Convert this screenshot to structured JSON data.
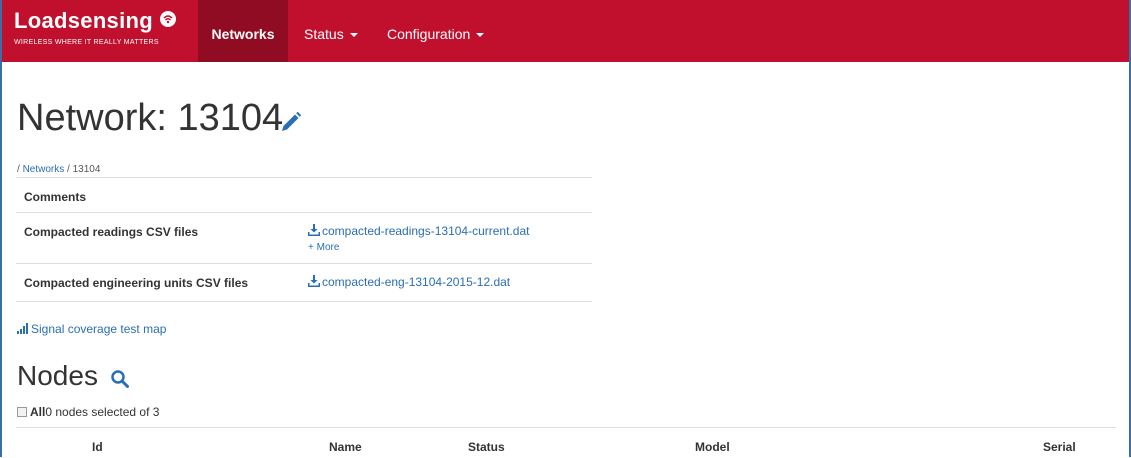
{
  "brand": {
    "name": "Loadsensing",
    "tagline": "WIRELESS WHERE IT REALLY MATTERS"
  },
  "nav": {
    "networks": "Networks",
    "status": "Status",
    "configuration": "Configuration"
  },
  "page": {
    "title": "Network: 13104",
    "breadcrumb": {
      "sep1": "/ ",
      "networks": "Networks",
      "sep2": " / ",
      "current": "13104"
    }
  },
  "info": {
    "comments_label": "Comments",
    "readings_label": "Compacted readings CSV files",
    "readings_file": "compacted-readings-13104-current.dat",
    "more": "+ More",
    "eng_label": "Compacted engineering units CSV files",
    "eng_file": "compacted-eng-13104-2015-12.dat"
  },
  "signal_link": "Signal coverage test map",
  "nodes": {
    "title": "Nodes",
    "all_label": "All",
    "selected_text": "0 nodes selected of 3",
    "columns": {
      "id": "Id",
      "name": "Name",
      "status": "Status",
      "model": "Model",
      "serial": "Serial"
    }
  },
  "colors": {
    "navbar": "#c0102e",
    "navbar_active": "#8f0c22",
    "link": "#2a6eb5"
  }
}
